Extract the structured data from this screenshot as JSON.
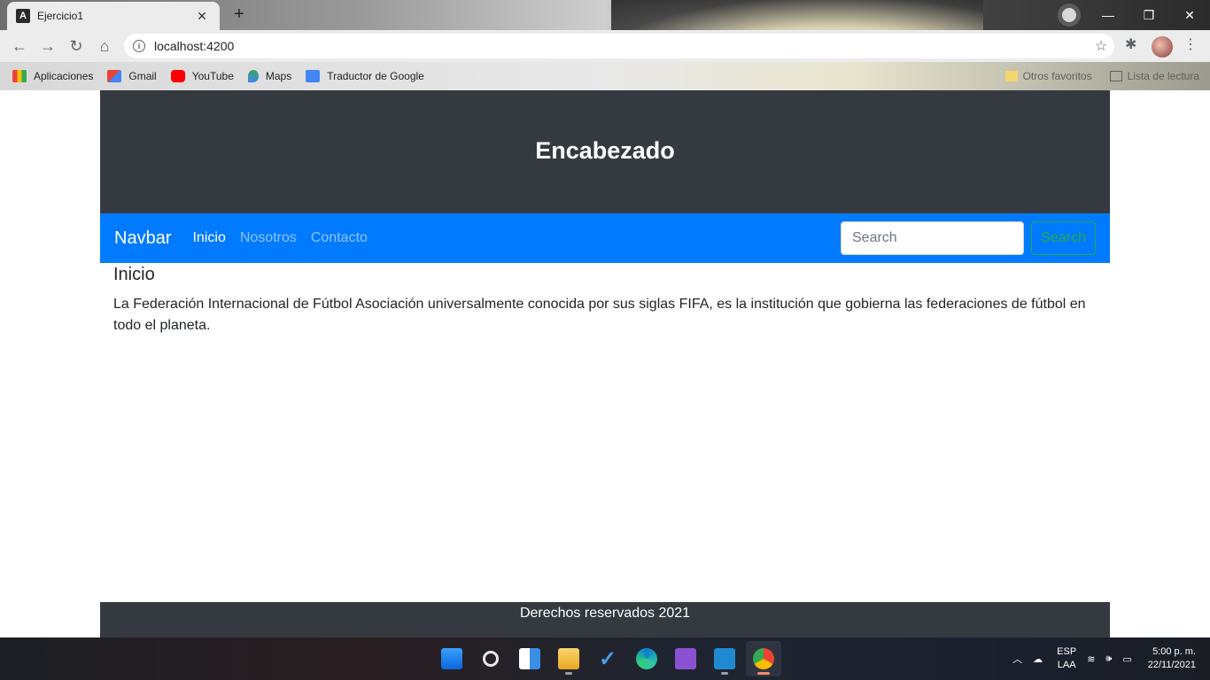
{
  "browser": {
    "tab_title": "Ejercicio1",
    "tab_favicon": "A",
    "tab_close": "✕",
    "new_tab": "+",
    "url": "localhost:4200",
    "window_controls": {
      "minimize": "—",
      "restore": "❐",
      "close": "✕"
    },
    "bookmarks": [
      {
        "label": "Aplicaciones",
        "icon": "apps-grid-icon"
      },
      {
        "label": "Gmail",
        "icon": "gmail-icon"
      },
      {
        "label": "YouTube",
        "icon": "youtube-icon"
      },
      {
        "label": "Maps",
        "icon": "maps-icon"
      },
      {
        "label": "Traductor de Google",
        "icon": "translate-icon"
      }
    ],
    "bookmarks_right": {
      "other": "Otros favoritos",
      "reading_list": "Lista de lectura"
    }
  },
  "page": {
    "header_title": "Encabezado",
    "navbar": {
      "brand": "Navbar",
      "links": [
        {
          "label": "Inicio",
          "active": true
        },
        {
          "label": "Nosotros",
          "active": false
        },
        {
          "label": "Contacto",
          "active": false
        }
      ],
      "search_placeholder": "Search",
      "search_button": "Search"
    },
    "content": {
      "heading": "Inicio",
      "paragraph": "La Federación Internacional de Fútbol Asociación  universalmente conocida por sus siglas FIFA, es la institución que gobierna las federaciones de fútbol en todo el planeta."
    },
    "footer": "Derechos reservados 2021"
  },
  "taskbar": {
    "apps": [
      "start-icon",
      "search-icon",
      "widgets-icon",
      "file-explorer-icon",
      "todo-icon",
      "edge-icon",
      "visual-studio-icon",
      "vscode-icon",
      "chrome-icon"
    ],
    "lang_top": "ESP",
    "lang_bottom": "LAA",
    "time": "5:00 p. m.",
    "date": "22/11/2021"
  },
  "colors": {
    "header_bg": "#343a40",
    "navbar_bg": "#007bff",
    "search_button": "#28a745",
    "footer_bg": "#343a40"
  }
}
